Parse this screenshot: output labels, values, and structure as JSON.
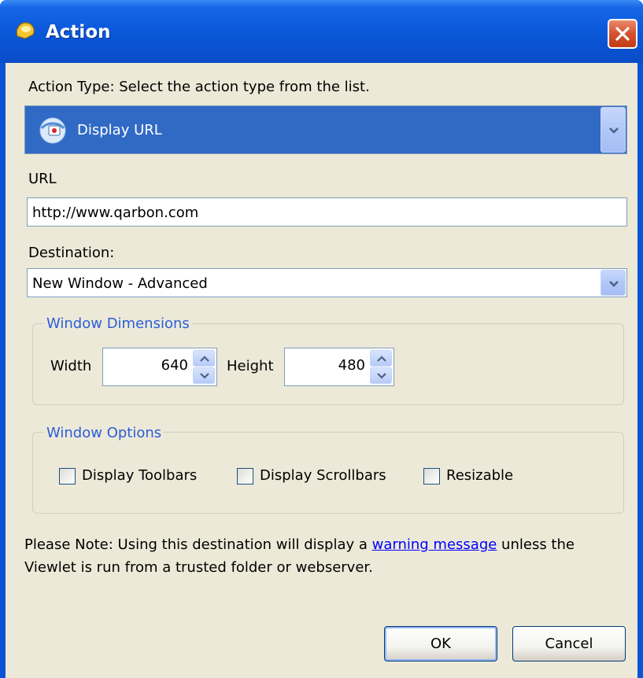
{
  "window": {
    "title": "Action"
  },
  "action_type": {
    "label": "Action Type: Select the action type from the list.",
    "selected": "Display URL"
  },
  "url": {
    "label": "URL",
    "value": "http://www.qarbon.com"
  },
  "destination": {
    "label": "Destination:",
    "selected": "New Window - Advanced"
  },
  "window_dimensions": {
    "legend": "Window Dimensions",
    "width_label": "Width",
    "width_value": "640",
    "height_label": "Height",
    "height_value": "480"
  },
  "window_options": {
    "legend": "Window Options",
    "options": [
      {
        "label": "Display Toolbars",
        "checked": false
      },
      {
        "label": "Display Scrollbars",
        "checked": false
      },
      {
        "label": "Resizable",
        "checked": false
      }
    ]
  },
  "note": {
    "prefix": "Please Note: Using this destination will display a ",
    "link": "warning message",
    "suffix": " unless the Viewlet is run from a trusted folder or webserver."
  },
  "buttons": {
    "ok": "OK",
    "cancel": "Cancel"
  },
  "colors": {
    "titlebar": "#0a54d6",
    "selection": "#316ac5",
    "legend": "#2a5ed8",
    "dialog_bg": "#ece9d8",
    "link": "#0000ff"
  }
}
